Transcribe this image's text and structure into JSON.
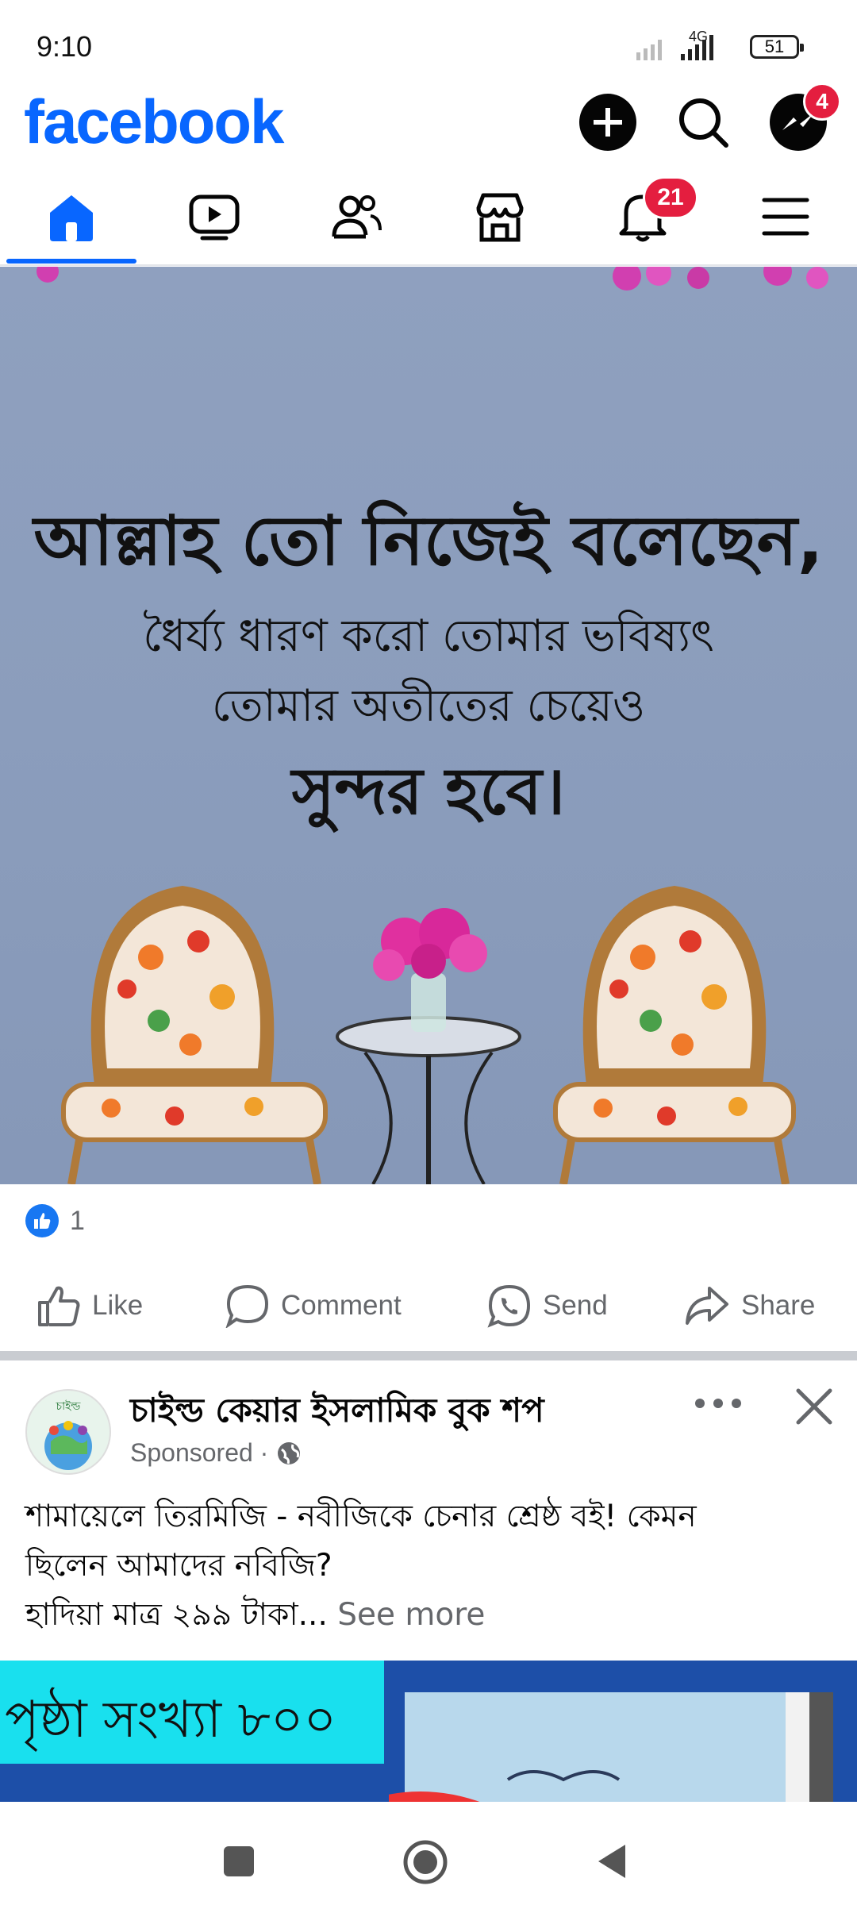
{
  "status_bar": {
    "time": "9:10",
    "network": "4G",
    "battery": "51"
  },
  "header": {
    "logo": "facebook",
    "messenger_badge": "4"
  },
  "tabs": {
    "notifications_badge": "21",
    "items": [
      "home",
      "video",
      "friends",
      "marketplace",
      "notifications",
      "menu"
    ]
  },
  "post": {
    "image_lines": [
      "আল্লাহ তো নিজেই বলেছেন,",
      "ধৈর্য্য ধারণ করো তোমার ভবিষ্যৎ",
      "তোমার অতীতের চেয়েও",
      "সুন্দর হবে।"
    ],
    "reaction_count": "1",
    "actions": {
      "like": "Like",
      "comment": "Comment",
      "send": "Send",
      "share": "Share"
    }
  },
  "ad": {
    "page_name": "চাইল্ড কেয়ার ইসলামিক বুক শপ",
    "sponsored_label": "Sponsored",
    "sponsored_separator": " · ",
    "text_line1": "শামায়েলে তিরমিজি - নবীজিকে চেনার শ্রেষ্ঠ বই! কেমন",
    "text_line2": "ছিলেন আমাদের নবিজি?",
    "text_line3": "হাদিয়া মাত্র ২৯৯ টাকা...",
    "see_more": " See more",
    "image_banner_text": "পৃষ্ঠা সংখ্যা ৮০০",
    "avatar_text": "চাইল্ড"
  },
  "colors": {
    "brand": "#0866ff",
    "badge": "#e41e3f",
    "muted": "#65676b"
  }
}
